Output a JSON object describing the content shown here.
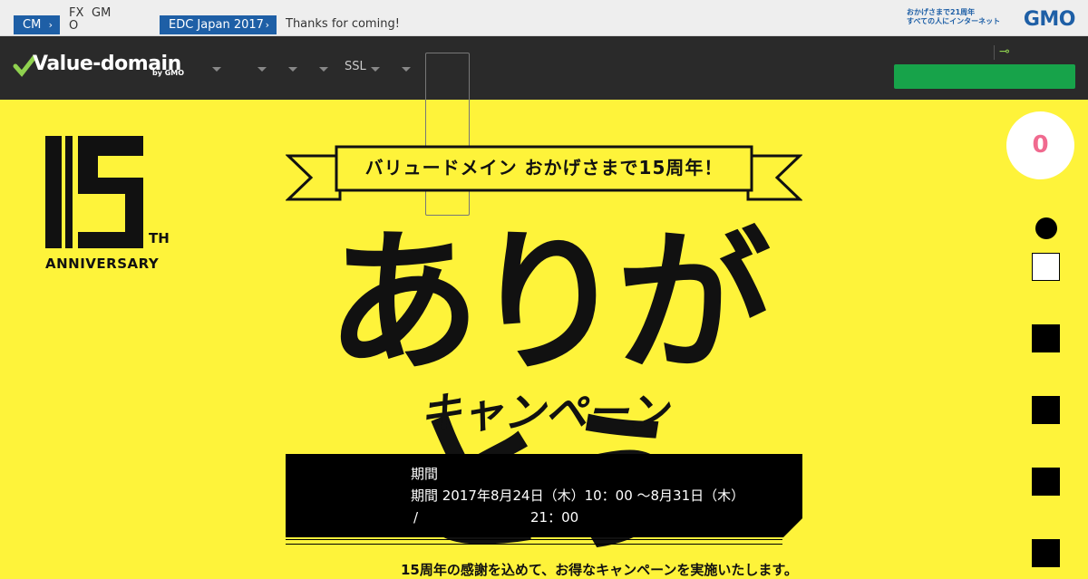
{
  "topbar": {
    "tag1": "CM",
    "mini1_line1": "FX",
    "mini1_line2": "O",
    "mini2": "GM",
    "tag2": "EDC Japan 2017",
    "message": "Thanks for coming!",
    "gmo_tagline_line1": "おかげさまで21周年",
    "gmo_tagline_line2": "すべての人にインターネット",
    "gmo_logo": "GMO"
  },
  "nav": {
    "logo": "Value-domain",
    "logo_by": "by GMO",
    "ssl_label": "SSL"
  },
  "side": {
    "counter": "0"
  },
  "hero": {
    "anniv_number": "15",
    "anniv_th": "TH",
    "anniv_word": "ANNIVERSARY",
    "ribbon": "バリュードメイン おかげさまで15周年！",
    "title": "ありがとう",
    "subtitle": "キャンペーン"
  },
  "period": {
    "line1": "期間",
    "line2": "期間 2017年8月24日（木）10：00 ～8月31日（木）",
    "line3_left": "/",
    "line3_right": "　21：00"
  },
  "intro": "15周年の感謝を込めて、お得なキャンペーンを実施いたします。",
  "colors": {
    "bg": "#fef33a",
    "nav": "#2a2a2a",
    "accent_blue": "#1e5fa6",
    "green": "#17a34a",
    "pink": "#f06a8f"
  }
}
